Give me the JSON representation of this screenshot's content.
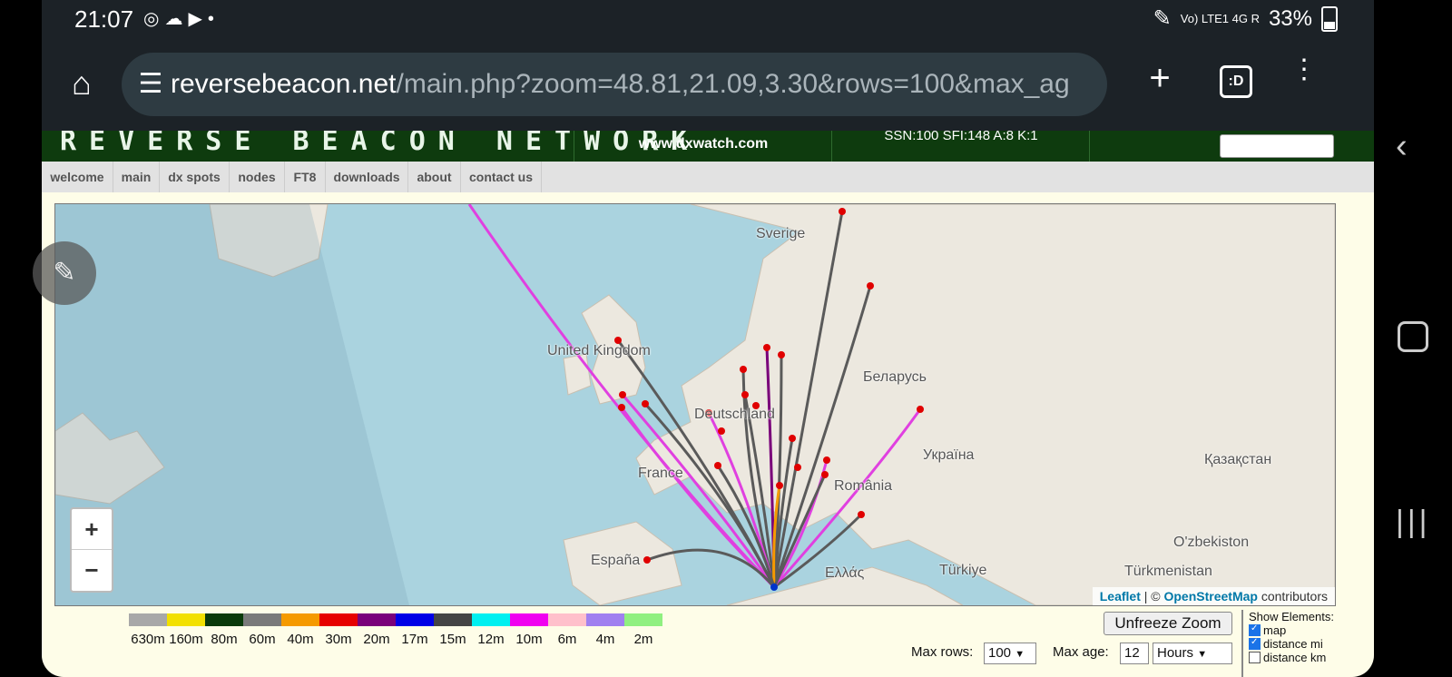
{
  "status_bar": {
    "time": "21:07",
    "left_icons": [
      "chrome-icon",
      "cloud-icon",
      "youtube-icon",
      "dot-icon"
    ],
    "network": "Vo) LTE1 4G R",
    "battery": "33%"
  },
  "browser": {
    "url_domain": "reversebeacon.net",
    "url_path": "/main.php?zoom=48.81,21.09,3.30&rows=100&max_ag",
    "tabs_badge": ":D"
  },
  "banner": {
    "logo": "REVERSE BEACON NETWORK",
    "dxwatch": "www.dxwatch.com",
    "solar": "SSN:100 SFI:148 A:8 K:1"
  },
  "nav": {
    "items": [
      {
        "label": "welcome"
      },
      {
        "label": "main"
      },
      {
        "label": "dx spots"
      },
      {
        "label": "nodes"
      },
      {
        "label": "FT8"
      },
      {
        "label": "downloads"
      },
      {
        "label": "about"
      },
      {
        "label": "contact us"
      }
    ]
  },
  "map": {
    "labels": [
      "Sverige",
      "United Kingdom",
      "Беларусь",
      "Deutschland",
      "Україна",
      "Қазақстан",
      "France",
      "România",
      "O'zbekiston",
      "España",
      "Ελλάς",
      "Türkiye",
      "Türkmenistan"
    ],
    "zoom_in": "+",
    "zoom_out": "−",
    "attribution": {
      "leaflet": "Leaflet",
      "sep": " | © ",
      "osm": "OpenStreetMap",
      "rest": " contributors"
    }
  },
  "legend": {
    "bands": [
      {
        "label": "630m",
        "color": "#a8a8a8"
      },
      {
        "label": "160m",
        "color": "#f2e000"
      },
      {
        "label": "80m",
        "color": "#0a3a0a"
      },
      {
        "label": "60m",
        "color": "#7a7a7a"
      },
      {
        "label": "40m",
        "color": "#f59a00"
      },
      {
        "label": "30m",
        "color": "#e60000"
      },
      {
        "label": "20m",
        "color": "#7a007a"
      },
      {
        "label": "17m",
        "color": "#0000e6"
      },
      {
        "label": "15m",
        "color": "#444444"
      },
      {
        "label": "12m",
        "color": "#00f0f0"
      },
      {
        "label": "10m",
        "color": "#f000f0"
      },
      {
        "label": "6m",
        "color": "#ffc0cb"
      },
      {
        "label": "4m",
        "color": "#a080f0"
      },
      {
        "label": "2m",
        "color": "#90f080"
      }
    ]
  },
  "controls": {
    "unfreeze": "Unfreeze Zoom",
    "max_rows_label": "Max rows:",
    "max_rows_value": "100",
    "max_age_label": "Max age:",
    "max_age_value": "12",
    "max_age_unit": "Hours",
    "show_elements_label": "Show Elements:",
    "show_items": [
      {
        "label": "map",
        "checked": true
      },
      {
        "label": "distance mi",
        "checked": true
      },
      {
        "label": "distance km",
        "checked": false
      }
    ]
  },
  "colors": {
    "path_gray": "#5a5a5a",
    "path_magenta": "#e040e0",
    "spot_red": "#e00000",
    "station_blue": "#0033cc"
  }
}
